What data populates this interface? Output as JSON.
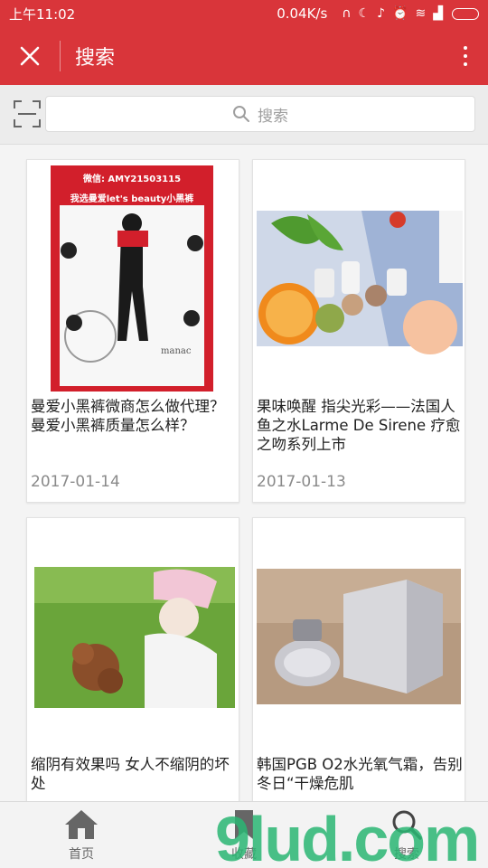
{
  "statusbar": {
    "time": "上午11:02",
    "speed": "0.04K/s"
  },
  "appbar": {
    "title": "搜索"
  },
  "search": {
    "placeholder": "搜索"
  },
  "articles": [
    {
      "title": "曼爱小黑裤微商怎么做代理？曼爱小黑裤质量怎么样？",
      "date": "2017-01-14",
      "poster_wechat": "微信: AMY21503115",
      "poster_slogan": "我选曼爱let's beauty小黑裤",
      "poster_brand": "manac"
    },
    {
      "title": "果味唤醒 指尖光彩——法国人鱼之水Larme De Sirene 疗愈之吻系列上市",
      "date": "2017-01-13"
    },
    {
      "title": "缩阴有效果吗 女人不缩阴的坏处",
      "date": ""
    },
    {
      "title": "韩国PGB O2水光氧气霜，告别冬日“干燥危肌",
      "date": ""
    }
  ],
  "bottomnav": {
    "items": [
      {
        "label": "首页",
        "icon": "home-icon"
      },
      {
        "label": "收藏",
        "icon": "bookmark-icon"
      },
      {
        "label": "搜索",
        "icon": "search-icon"
      }
    ]
  },
  "watermark": "9lud.com",
  "colors": {
    "accent": "#d9353a",
    "nav_bg": "#f3f3f3"
  }
}
